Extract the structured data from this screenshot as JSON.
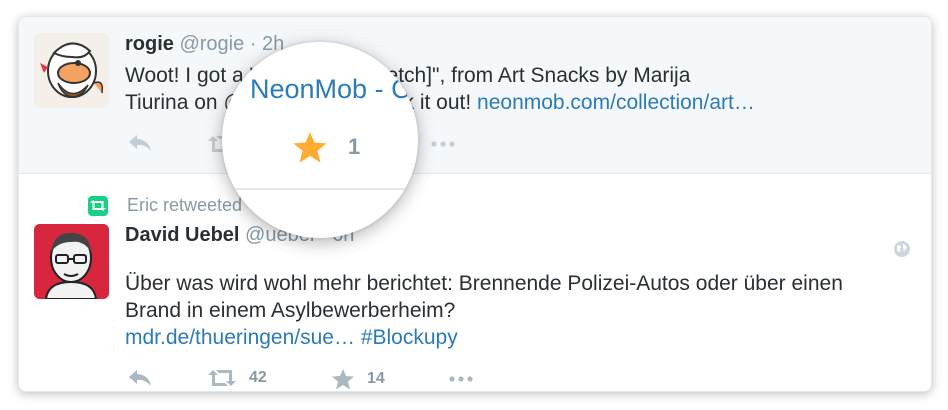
{
  "tweets": [
    {
      "name": "rogie",
      "handle": "@rogie",
      "time": "· 2h",
      "line1": "Woot! I got a \"Pretzelcat [Sketch]\", from Art Snacks  by Marija",
      "line2_prefix": "Tiurina on @NeonMob - Check it out! ",
      "line2_link": "neonmob.com/collection/art…",
      "actions": {
        "reply": "reply-icon",
        "retweet": "retweet-icon",
        "favorite": "star-icon",
        "more": "more-icon"
      }
    },
    {
      "retweeted_by": "Eric retweeted",
      "name": "David Uebel",
      "handle": "@uebel",
      "time": "· 6h",
      "line1": "Über was wird wohl mehr berichtet: Brennende Polizei-Autos oder über einen",
      "line2": "Brand in einem Asylbewerberheim?",
      "link1": "mdr.de/thueringen/sue…",
      "hashtag": "#Blockupy",
      "retweet_count": "42",
      "favorite_count": "14"
    }
  ],
  "magnifier": {
    "text": "NeonMob - C",
    "favorite_count": "1"
  },
  "colors": {
    "link": "#2b7bb9",
    "star_active": "#ffac33",
    "muted": "#8899a6",
    "retweet_green": "#19cf86"
  }
}
